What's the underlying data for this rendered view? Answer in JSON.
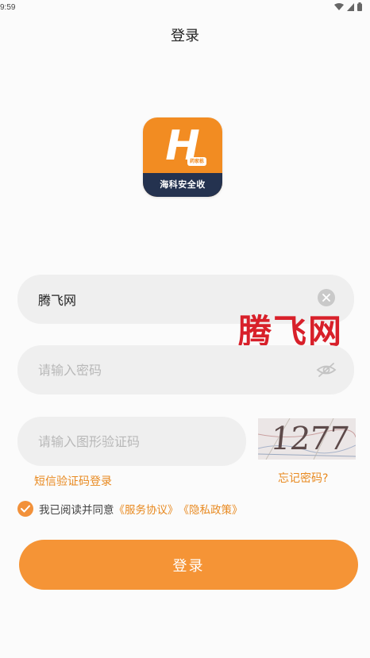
{
  "status": {
    "time": "9:59"
  },
  "header": {
    "title": "登录"
  },
  "logo": {
    "letter": "H",
    "badge": "药家栋",
    "band": "海科安全收"
  },
  "username": {
    "value": "腾飞网"
  },
  "password": {
    "placeholder": "请输入密码"
  },
  "captcha": {
    "placeholder": "请输入图形验证码",
    "image_text": "1277"
  },
  "watermark": {
    "text": "腾飞网"
  },
  "links": {
    "sms_login": "短信验证码登录",
    "forgot": "忘记密码?"
  },
  "agreement": {
    "prefix": "我已阅读并同意",
    "service": "《服务协议》",
    "privacy": "《隐私政策》",
    "checked": true
  },
  "login_button": {
    "label": "登录"
  },
  "colors": {
    "accent": "#f59436",
    "link": "#e8891f",
    "logo_band": "#24324f",
    "watermark": "#d8202a"
  }
}
